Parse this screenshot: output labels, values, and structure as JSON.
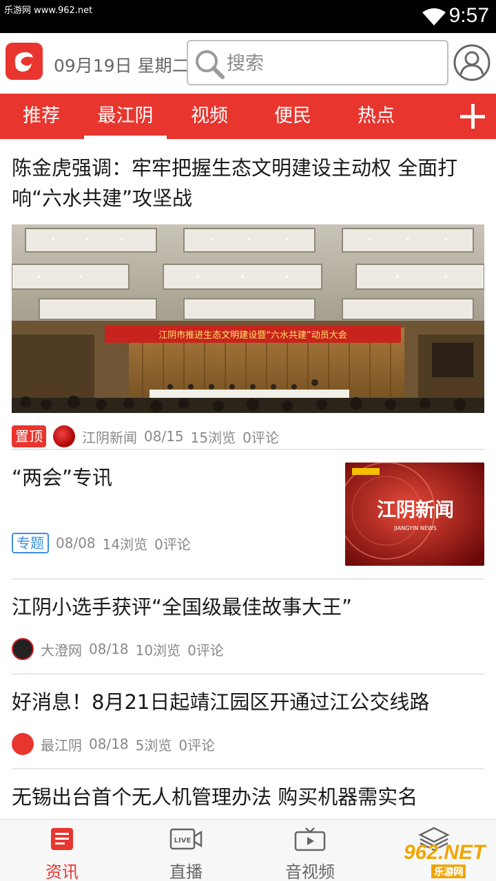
{
  "status_bar": {
    "watermark": "乐游网 www.962.net",
    "time": "9:57"
  },
  "header": {
    "date": "09月19日 星期二",
    "search_placeholder": "搜索"
  },
  "tabs": [
    {
      "label": "推荐",
      "active": false
    },
    {
      "label": "最江阴",
      "active": true
    },
    {
      "label": "视频",
      "active": false
    },
    {
      "label": "便民",
      "active": false
    },
    {
      "label": "热点",
      "active": false
    }
  ],
  "feed": [
    {
      "title": "陈金虎强调：牢牢把握生态文明建设主动权 全面打响“六水共建”攻坚战",
      "banner_text": "江阴市推进生态文明建设暨“六水共建”动员大会",
      "badge": "置顶",
      "source": "江阴新闻",
      "date": "08/15",
      "views": "15浏览",
      "comments": "0评论"
    },
    {
      "title": "“两会”专讯",
      "badge": "专题",
      "date": "08/08",
      "views": "14浏览",
      "comments": "0评论",
      "thumb_text": "江阴新闻",
      "thumb_sub": "JIANGYIN NEWS"
    },
    {
      "title": "江阴小选手获评“全国级最佳故事大王”",
      "source": "大澄网",
      "date": "08/18",
      "views": "10浏览",
      "comments": "0评论"
    },
    {
      "title": "好消息！8月21日起靖江园区开通过江公交线路",
      "source": "最江阴",
      "date": "08/18",
      "views": "5浏览",
      "comments": "0评论"
    },
    {
      "title": "无锡出台首个无人机管理办法 购买机器需实名"
    }
  ],
  "bottom_nav": [
    {
      "label": "资讯",
      "icon": "news-icon",
      "active": true
    },
    {
      "label": "直播",
      "icon": "live-icon",
      "active": false
    },
    {
      "label": "音视频",
      "icon": "video-icon",
      "active": false
    },
    {
      "label": "",
      "icon": "layers-icon",
      "active": false
    }
  ],
  "bottom_watermark": {
    "brand": "962.NET",
    "sub": "乐游网"
  },
  "colors": {
    "brand_red": "#e8352e",
    "topic_blue": "#3b8fe0"
  }
}
